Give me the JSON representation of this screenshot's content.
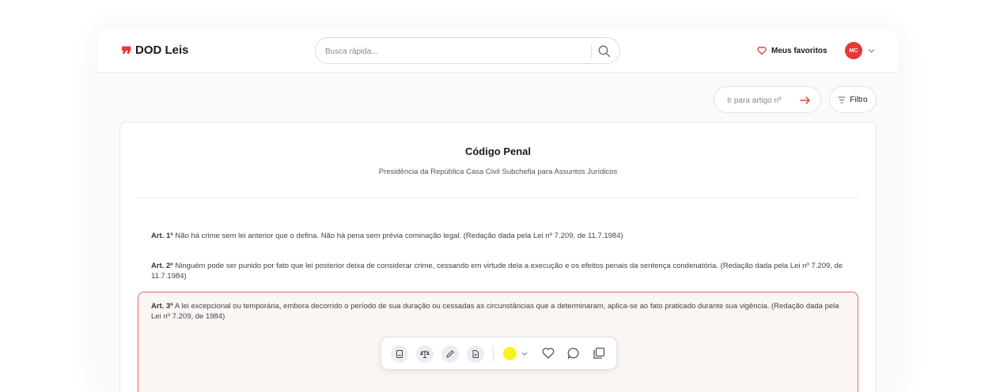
{
  "header": {
    "logo_mark": "❞",
    "logo_text": "DOD Leis",
    "search_placeholder": "Busca rápida...",
    "favorites_label": "Meus favoritos",
    "avatar_initials": "MC"
  },
  "controls": {
    "goto_placeholder": "Ir para artigo nº",
    "filter_label": "Filtro"
  },
  "document": {
    "title": "Código Penal",
    "subtitle": "Presidência da República Casa Civil Subchefia para Assuntos Jurídicos",
    "articles": [
      {
        "num": "Art. 1º",
        "text": " Não há crime sem lei anterior que o defina. Não há pena sem prévia cominação legal. (Redação dada pela Lei nº 7.209, de 11.7.1984)"
      },
      {
        "num": "Art. 2º",
        "text": " Ninguém pode ser punido por fato que lei posterior deixa de considerar crime, cessando em virtude dela a execução e os efeitos penais da sentença condenatória. (Redação dada pela Lei nº 7.209, de 11.7.1984)"
      },
      {
        "num": "Art. 3º",
        "text": " A lei excepcional ou temporária, embora decorrido o período de sua duração ou cessadas as circunstâncias que a determinaram, aplica-se ao fato praticado durante sua vigência. (Redação dada pela Lei nº 7.209, de 1984)"
      }
    ]
  },
  "toolbar": {
    "tools": [
      "book-icon",
      "scale-icon",
      "pencil-icon",
      "document-link-icon"
    ],
    "highlight_color": "#f5f51e",
    "actions": [
      "heart-icon",
      "comment-icon",
      "copy-icon"
    ]
  },
  "colors": {
    "accent": "#e53935",
    "selected_border": "#e6675e",
    "selected_background": "#fbf5f4"
  }
}
